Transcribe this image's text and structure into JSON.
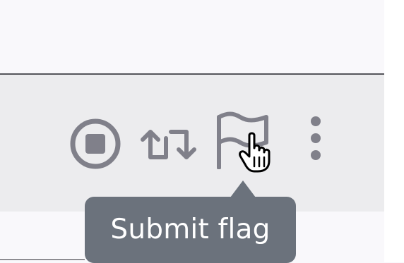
{
  "toolbar": {
    "buttons": [
      {
        "name": "stop",
        "icon": "stop-circle-icon"
      },
      {
        "name": "swap",
        "icon": "swap-arrows-icon"
      },
      {
        "name": "submit-flag",
        "icon": "flag-icon"
      },
      {
        "name": "more",
        "icon": "more-vertical-icon"
      }
    ]
  },
  "tooltip": {
    "label": "Submit flag"
  },
  "colors": {
    "page_background": "#f9f8fb",
    "toolbar_background": "#ececee",
    "toolbar_border": "#55555a",
    "icon_color": "#80808a",
    "tooltip_background": "#6b727c",
    "tooltip_text": "#ffffff"
  },
  "cursor": {
    "icon": "hand-pointer-icon"
  }
}
